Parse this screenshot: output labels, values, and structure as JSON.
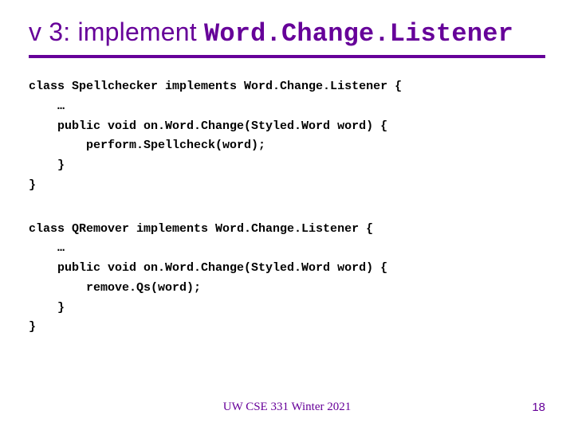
{
  "title": {
    "prefix": "v 3: implement ",
    "mono": "Word.Change.Listener"
  },
  "code1": "class Spellchecker implements Word.Change.Listener {\n    …\n    public void on.Word.Change(Styled.Word word) {\n        perform.Spellcheck(word);\n    }\n}",
  "code2": "class QRemover implements Word.Change.Listener {\n    …\n    public void on.Word.Change(Styled.Word word) {\n        remove.Qs(word);\n    }\n}",
  "footer": "UW CSE 331 Winter 2021",
  "page": "18"
}
